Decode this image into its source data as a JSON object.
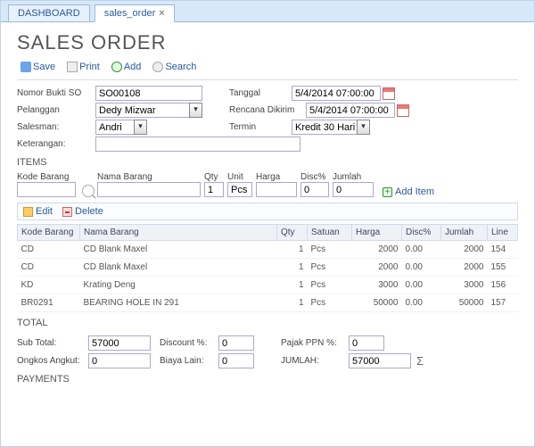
{
  "tabs": {
    "dashboard": "DASHBOARD",
    "active": "sales_order"
  },
  "title": "SALES ORDER",
  "toolbar": {
    "save": "Save",
    "print": "Print",
    "add": "Add",
    "search": "Search"
  },
  "form": {
    "labels": {
      "nomor": "Nomor Bukti SO",
      "tanggal": "Tanggal",
      "pelanggan": "Pelanggan",
      "rencana": "Rencana Dikirim",
      "salesman": "Salesman:",
      "termin": "Termin",
      "keterangan": "Keterangan:"
    },
    "values": {
      "nomor": "SO00108",
      "tanggal": "5/4/2014 07:00:00",
      "pelanggan": "Dedy Mizwar",
      "rencana": "5/4/2014 07:00:00",
      "salesman": "Andri",
      "termin": "Kredit 30 Hari",
      "keterangan": ""
    }
  },
  "items": {
    "title": "ITEMS",
    "filter_labels": {
      "kode": "Kode Barang",
      "nama": "Nama Barang",
      "qty": "Qty",
      "unit": "Unit",
      "harga": "Harga",
      "disc": "Disc%",
      "jumlah": "Jumlah"
    },
    "filter_values": {
      "kode": "",
      "nama": "",
      "qty": "1",
      "unit": "Pcs",
      "harga": "",
      "disc": "0",
      "jumlah": "0"
    },
    "add_item": "Add Item",
    "edit": "Edit",
    "delete": "Delete",
    "headers": {
      "kode": "Kode Barang",
      "nama": "Nama Barang",
      "qty": "Qty",
      "satuan": "Satuan",
      "harga": "Harga",
      "disc": "Disc%",
      "jumlah": "Jumlah",
      "line": "Line"
    },
    "rows": [
      {
        "kode": "CD",
        "nama": "CD Blank Maxel",
        "qty": "1",
        "satuan": "Pcs",
        "harga": "2000",
        "disc": "0.00",
        "jumlah": "2000",
        "line": "154"
      },
      {
        "kode": "CD",
        "nama": "CD Blank Maxel",
        "qty": "1",
        "satuan": "Pcs",
        "harga": "2000",
        "disc": "0.00",
        "jumlah": "2000",
        "line": "155"
      },
      {
        "kode": "KD",
        "nama": "Krating Deng",
        "qty": "1",
        "satuan": "Pcs",
        "harga": "3000",
        "disc": "0.00",
        "jumlah": "3000",
        "line": "156"
      },
      {
        "kode": "BR0291",
        "nama": "BEARING HOLE IN 291",
        "qty": "1",
        "satuan": "Pcs",
        "harga": "50000",
        "disc": "0.00",
        "jumlah": "50000",
        "line": "157"
      }
    ]
  },
  "totals": {
    "title": "TOTAL",
    "labels": {
      "sub": "Sub Total:",
      "disc": "Discount %:",
      "ppn": "Pajak PPN %:",
      "ongkos": "Ongkos Angkut:",
      "biaya": "Biaya Lain:",
      "jumlah": "JUMLAH:"
    },
    "values": {
      "sub": "57000",
      "disc": "0",
      "ppn": "0",
      "ongkos": "0",
      "biaya": "0",
      "jumlah": "57000"
    }
  },
  "payments": {
    "title": "PAYMENTS"
  }
}
